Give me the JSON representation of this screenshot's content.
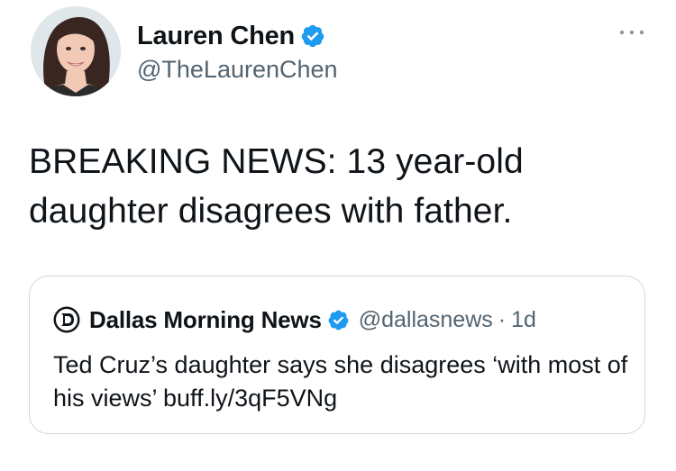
{
  "tweet": {
    "author": {
      "display_name": "Lauren Chen",
      "handle": "@TheLaurenChen",
      "verified": true
    },
    "text": "BREAKING NEWS: 13 year-old daughter disagrees with father.",
    "more_icon": "more-horizontal-icon"
  },
  "quote": {
    "author": {
      "display_name": "Dallas Morning News",
      "handle": "@dallasnews",
      "separator": "·",
      "time": "1d",
      "verified": true
    },
    "text": "Ted Cruz’s daughter says she disagrees ‘with most of his views’ buff.ly/3qF5VNg"
  },
  "colors": {
    "text_primary": "#0f1419",
    "text_secondary": "#536471",
    "verified_blue": "#1d9bf0",
    "border": "#cfd9de"
  }
}
